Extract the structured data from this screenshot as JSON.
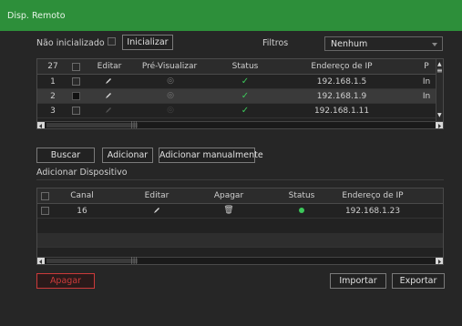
{
  "window": {
    "title": "Disp. Remoto"
  },
  "top_bar": {
    "uninitialized_label": "Não inicializado",
    "initialize_button": "Inicializar",
    "filter_label": "Filtros",
    "filter_value": "Nenhum"
  },
  "device_table": {
    "count": "27",
    "columns": [
      "Editar",
      "Pré-Visualizar",
      "Status",
      "Endereço de IP",
      "P"
    ],
    "rows": [
      {
        "num": "1",
        "ip": "192.168.1.5",
        "port": "In"
      },
      {
        "num": "2",
        "ip": "192.168.1.9",
        "port": "In"
      },
      {
        "num": "3",
        "ip": "192.168.1.11",
        "port": ""
      }
    ]
  },
  "actions": {
    "search": "Buscar",
    "add": "Adicionar",
    "add_manual": "Adicionar manualmente"
  },
  "added_section": {
    "title": "Adicionar Dispositivo",
    "columns": [
      "Canal",
      "Editar",
      "Apagar",
      "Status",
      "Endereço de IP"
    ],
    "rows": [
      {
        "channel": "16",
        "ip": "192.168.1.23"
      }
    ]
  },
  "bottom": {
    "delete": "Apagar",
    "import": "Importar",
    "export": "Exportar"
  },
  "colors": {
    "title_bar": "#2d8f3a",
    "online": "#3cc75a",
    "danger": "#cc3a3a"
  },
  "icons": [
    "checkbox-icon",
    "pencil-icon",
    "eye-icon",
    "check-icon",
    "trash-icon",
    "status-dot-icon",
    "scroll-arrow-icon"
  ]
}
